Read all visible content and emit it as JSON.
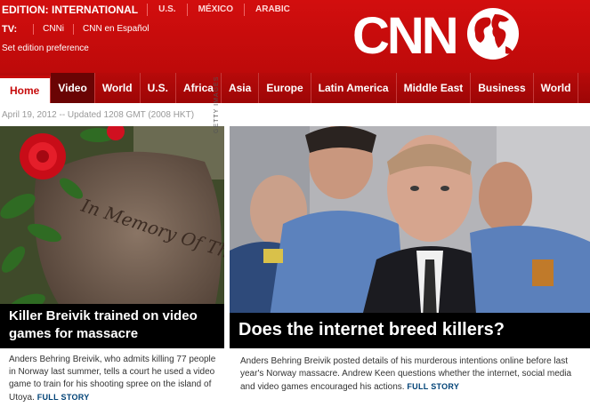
{
  "edition": {
    "label": "EDITION:  INTERNATIONAL",
    "links": [
      "U.S.",
      "MÉXICO",
      "ARABIC"
    ]
  },
  "tv": {
    "label": "TV:",
    "links": [
      "CNNi",
      "CNN en Español"
    ]
  },
  "preference": "Set edition preference",
  "logo": "CNN",
  "nav": [
    "Home",
    "Video",
    "World",
    "U.S.",
    "Africa",
    "Asia",
    "Europe",
    "Latin America",
    "Middle East",
    "Business",
    "World"
  ],
  "dateline": "April 19, 2012 -- Updated 1208 GMT (2008 HKT)",
  "photo_credit": "GETTY IMAGES",
  "memorial_text": "In Memory Of The Victims",
  "story_left": {
    "headline": "Killer Breivik trained on video games for massacre",
    "summary": "Anders Behring Breivik, who admits killing 77 people in Norway last summer, tells a court he used a video game to train for his shooting spree on the island of Utoya.",
    "link": "FULL STORY"
  },
  "story_right": {
    "headline": "Does the internet breed killers?",
    "summary": "Anders Behring Breivik posted details of his murderous intentions online before last year's Norway massacre. Andrew Keen questions whether the internet, social media and video games encouraged his actions.",
    "link": "FULL STORY"
  },
  "colors": {
    "brand_red": "#c60b0b",
    "nav_red": "#a70808",
    "link_blue": "#004276"
  }
}
